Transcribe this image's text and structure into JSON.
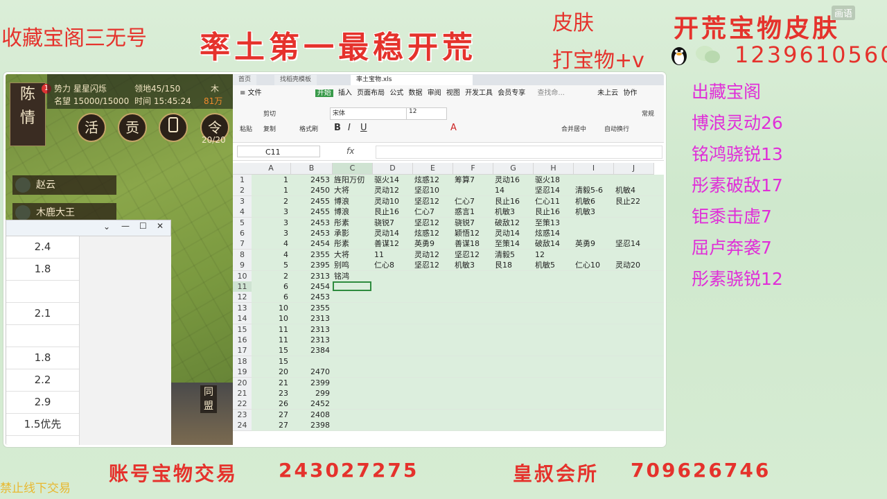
{
  "overlay": {
    "top_left": "收藏宝阁三无号",
    "banner": "率土第一最稳开荒",
    "skin": "皮肤",
    "dabao": "打宝物+v",
    "right_title": "开荒宝物皮肤",
    "qq_number": "1239610560",
    "corner_label": "画语",
    "bottom_left_label": "账号宝物交易",
    "bottom_left_number": "243027275",
    "bottom_right_label": "皇叔会所",
    "bottom_right_number": "709626746",
    "footer_note": "禁止线下交易"
  },
  "right_list": [
    "出藏宝阁",
    "博浪灵动26",
    "铭鸿骁锐13",
    "彤素破敌17",
    "钜黍击虚7",
    "屈卢奔袭7",
    "彤素骁锐12"
  ],
  "game": {
    "faction": "势力 星星闪烁",
    "fame": "名望 15000/15000",
    "territory": "领地45/150",
    "time": "时间 15:45:24",
    "wood": "木",
    "wood_amt": "81万",
    "portrait_chars": [
      "陈",
      "情"
    ],
    "buttons": [
      "活",
      "贡",
      "令"
    ],
    "count": "20/20",
    "badge": "1",
    "units": [
      "赵云",
      "木鹿大王"
    ],
    "side_chars": [
      "同",
      "盟"
    ]
  },
  "small_window": {
    "values": [
      "2.4",
      "1.8",
      "",
      "2.1",
      "",
      "1.8",
      "2.2",
      "2.9",
      "1.5优先"
    ]
  },
  "sheet": {
    "tabs": [
      "首页",
      "找稻壳模板",
      "率土宝物.xls"
    ],
    "menu": [
      "≡ 文件",
      "开始",
      "插入",
      "页面布局",
      "公式",
      "数据",
      "审阅",
      "视图",
      "开发工具",
      "会员专享"
    ],
    "search": "查找命...",
    "cloud": "未上云",
    "collab": "协作",
    "font_name": "宋体",
    "font_size": "12",
    "ribbon": {
      "paste": "粘贴",
      "cut": "剪切",
      "copy": "复制",
      "format_painter": "格式刷",
      "merge": "合并居中",
      "wrap": "自动换行",
      "normal": "常规"
    },
    "cell_ref": "C11",
    "fx": "fx",
    "columns": [
      "A",
      "B",
      "C",
      "D",
      "E",
      "F",
      "G",
      "H",
      "I",
      "J"
    ],
    "rows": [
      [
        "1",
        "1",
        "2453",
        "旌阳万仞",
        "驱火14",
        "炫惑12",
        "筹算7",
        "灵动16",
        "驱火18",
        "",
        ""
      ],
      [
        "2",
        "1",
        "2450",
        "大将",
        "灵动12",
        "坚忍10",
        "",
        "14",
        "坚忍14",
        "清毅5-6",
        "机敏4"
      ],
      [
        "3",
        "2",
        "2455",
        "博浪",
        "灵动10",
        "坚忍12",
        "仁心7",
        "艮止16",
        "仁心11",
        "机敏6",
        "艮止22"
      ],
      [
        "4",
        "3",
        "2455",
        "博浪",
        "艮止16",
        "仁心7",
        "惑言1",
        "机敏3",
        "艮止16",
        "机敏3",
        ""
      ],
      [
        "5",
        "3",
        "2453",
        "彤素",
        "骁锐7",
        "坚忍12",
        "骁锐7",
        "破敌12",
        "至策13",
        "",
        ""
      ],
      [
        "6",
        "3",
        "2453",
        "承影",
        "灵动14",
        "炫惑12",
        "颖悟12",
        "灵动14",
        "炫惑14",
        "",
        ""
      ],
      [
        "7",
        "4",
        "2454",
        "彤素",
        "善谋12",
        "英勇9",
        "善谋18",
        "至策14",
        "破敌14",
        "英勇9",
        "坚忍14"
      ],
      [
        "8",
        "4",
        "2355",
        "大将",
        "11",
        "灵动12",
        "坚忍12",
        "清毅5",
        "12",
        "",
        ""
      ],
      [
        "9",
        "5",
        "2395",
        "别鸣",
        "仁心8",
        "坚忍12",
        "机敏3",
        "艮18",
        "机敏5",
        "仁心10",
        "灵动20"
      ],
      [
        "10",
        "2",
        "2313",
        "铭鸿",
        "",
        "",
        "",
        "",
        "",
        "",
        ""
      ],
      [
        "11",
        "6",
        "2454",
        "",
        "",
        "",
        "",
        "",
        "",
        "",
        ""
      ],
      [
        "12",
        "6",
        "2453",
        "",
        "",
        "",
        "",
        "",
        "",
        "",
        ""
      ],
      [
        "13",
        "10",
        "2355",
        "",
        "",
        "",
        "",
        "",
        "",
        "",
        ""
      ],
      [
        "14",
        "10",
        "2313",
        "",
        "",
        "",
        "",
        "",
        "",
        "",
        ""
      ],
      [
        "15",
        "11",
        "2313",
        "",
        "",
        "",
        "",
        "",
        "",
        "",
        ""
      ],
      [
        "16",
        "11",
        "2313",
        "",
        "",
        "",
        "",
        "",
        "",
        "",
        ""
      ],
      [
        "17",
        "15",
        "2384",
        "",
        "",
        "",
        "",
        "",
        "",
        "",
        ""
      ],
      [
        "18",
        "15",
        "",
        "",
        "",
        "",
        "",
        "",
        "",
        "",
        ""
      ],
      [
        "19",
        "20",
        "2470",
        "",
        "",
        "",
        "",
        "",
        "",
        "",
        ""
      ],
      [
        "20",
        "21",
        "2399",
        "",
        "",
        "",
        "",
        "",
        "",
        "",
        ""
      ],
      [
        "21",
        "23",
        "299",
        "",
        "",
        "",
        "",
        "",
        "",
        "",
        ""
      ],
      [
        "22",
        "26",
        "2452",
        "",
        "",
        "",
        "",
        "",
        "",
        "",
        ""
      ],
      [
        "23",
        "27",
        "2408",
        "",
        "",
        "",
        "",
        "",
        "",
        "",
        ""
      ],
      [
        "24",
        "27",
        "2398",
        "",
        "",
        "",
        "",
        "",
        "",
        "",
        ""
      ]
    ]
  },
  "colors": {
    "red": "#e5322c",
    "magenta": "#e02ed8",
    "sheet_fill": "#dceedd"
  }
}
